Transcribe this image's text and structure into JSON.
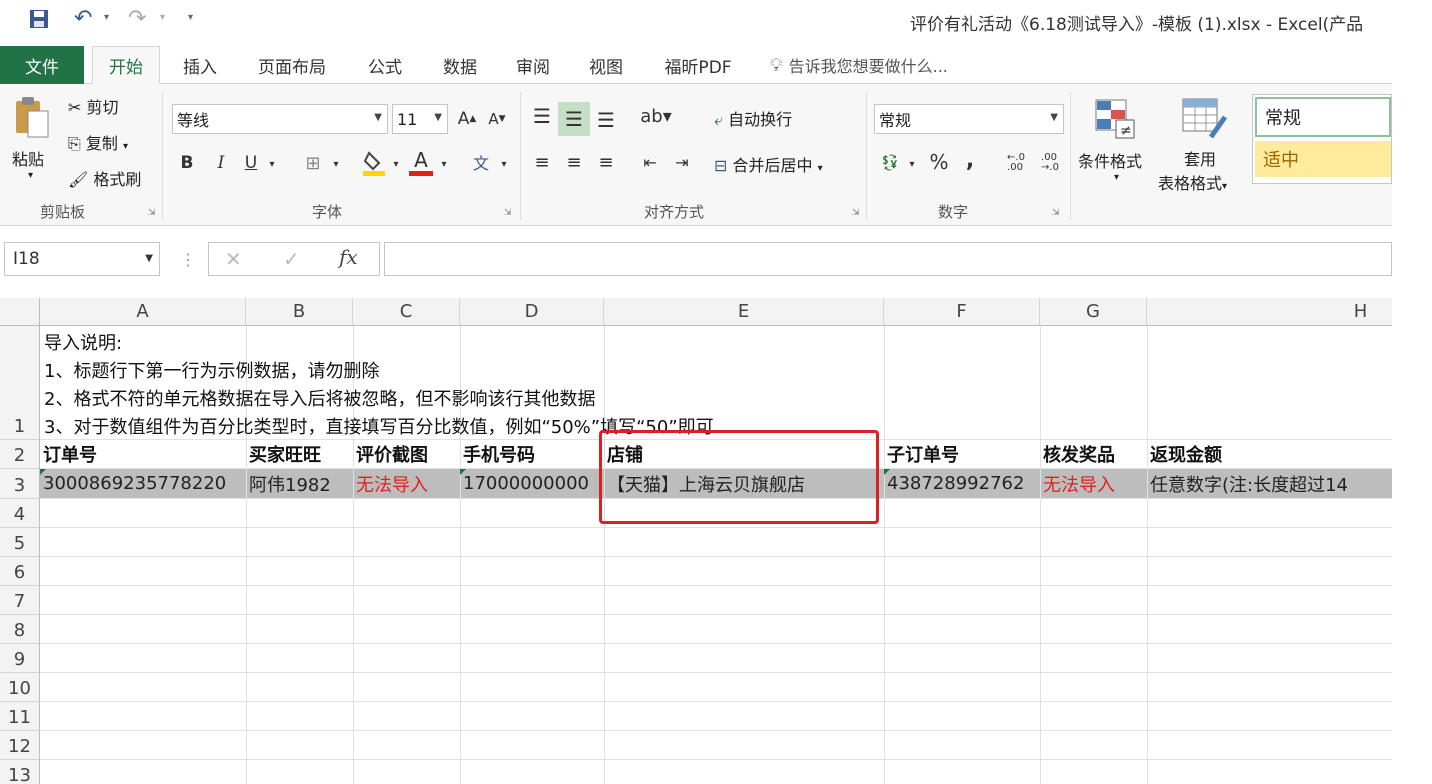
{
  "window": {
    "title": "评价有礼活动《6.18测试导入》-模板 (1).xlsx - Excel(产品"
  },
  "tabs": {
    "file": "文件",
    "items": [
      "开始",
      "插入",
      "页面布局",
      "公式",
      "数据",
      "审阅",
      "视图",
      "福昕PDF"
    ],
    "tell_me": "告诉我您想要做什么..."
  },
  "ribbon": {
    "clipboard": {
      "paste": "粘贴",
      "cut": "剪切",
      "copy": "复制",
      "format_painter": "格式刷",
      "label": "剪贴板"
    },
    "font": {
      "name": "等线",
      "size": "11",
      "bold": "B",
      "italic": "I",
      "underline": "U",
      "label": "字体"
    },
    "alignment": {
      "wrap": "自动换行",
      "merge": "合并后居中",
      "label": "对齐方式"
    },
    "number": {
      "format": "常规",
      "percent": "%",
      "comma": ",",
      "label": "数字"
    },
    "styles": {
      "conditional": "条件格式",
      "table_line1": "套用",
      "table_line2": "表格格式",
      "style_normal": "常规",
      "style_neutral": "适中"
    }
  },
  "formula_bar": {
    "name_box": "I18",
    "formula": ""
  },
  "sheet": {
    "columns": [
      "A",
      "B",
      "C",
      "D",
      "E",
      "F",
      "G",
      "H"
    ],
    "rows": [
      "1",
      "2",
      "3",
      "4",
      "5",
      "6",
      "7",
      "8",
      "9",
      "10",
      "11",
      "12",
      "13"
    ],
    "instructions": [
      "导入说明:",
      "1、标题行下第一行为示例数据，请勿删除",
      "2、格式不符的单元格数据在导入后将被忽略，但不影响该行其他数据",
      "3、对于数值组件为百分比类型时，直接填写百分比数值，例如“50%”填写“50”即可"
    ],
    "headers": [
      "订单号",
      "买家旺旺",
      "评价截图",
      "手机号码",
      "店铺",
      "子订单号",
      "核发奖品",
      "返现金额"
    ],
    "example_row": [
      "3000869235778220",
      "阿伟1982",
      "无法导入",
      "17000000000",
      "【天猫】上海云贝旗舰店",
      "438728992762",
      "无法导入",
      "任意数字(注:长度超过14"
    ]
  },
  "colors": {
    "excel_green": "#217346",
    "invalid_red": "#e0201d",
    "highlight_red": "#d92027",
    "neutral_style": "#ffeb9c"
  }
}
